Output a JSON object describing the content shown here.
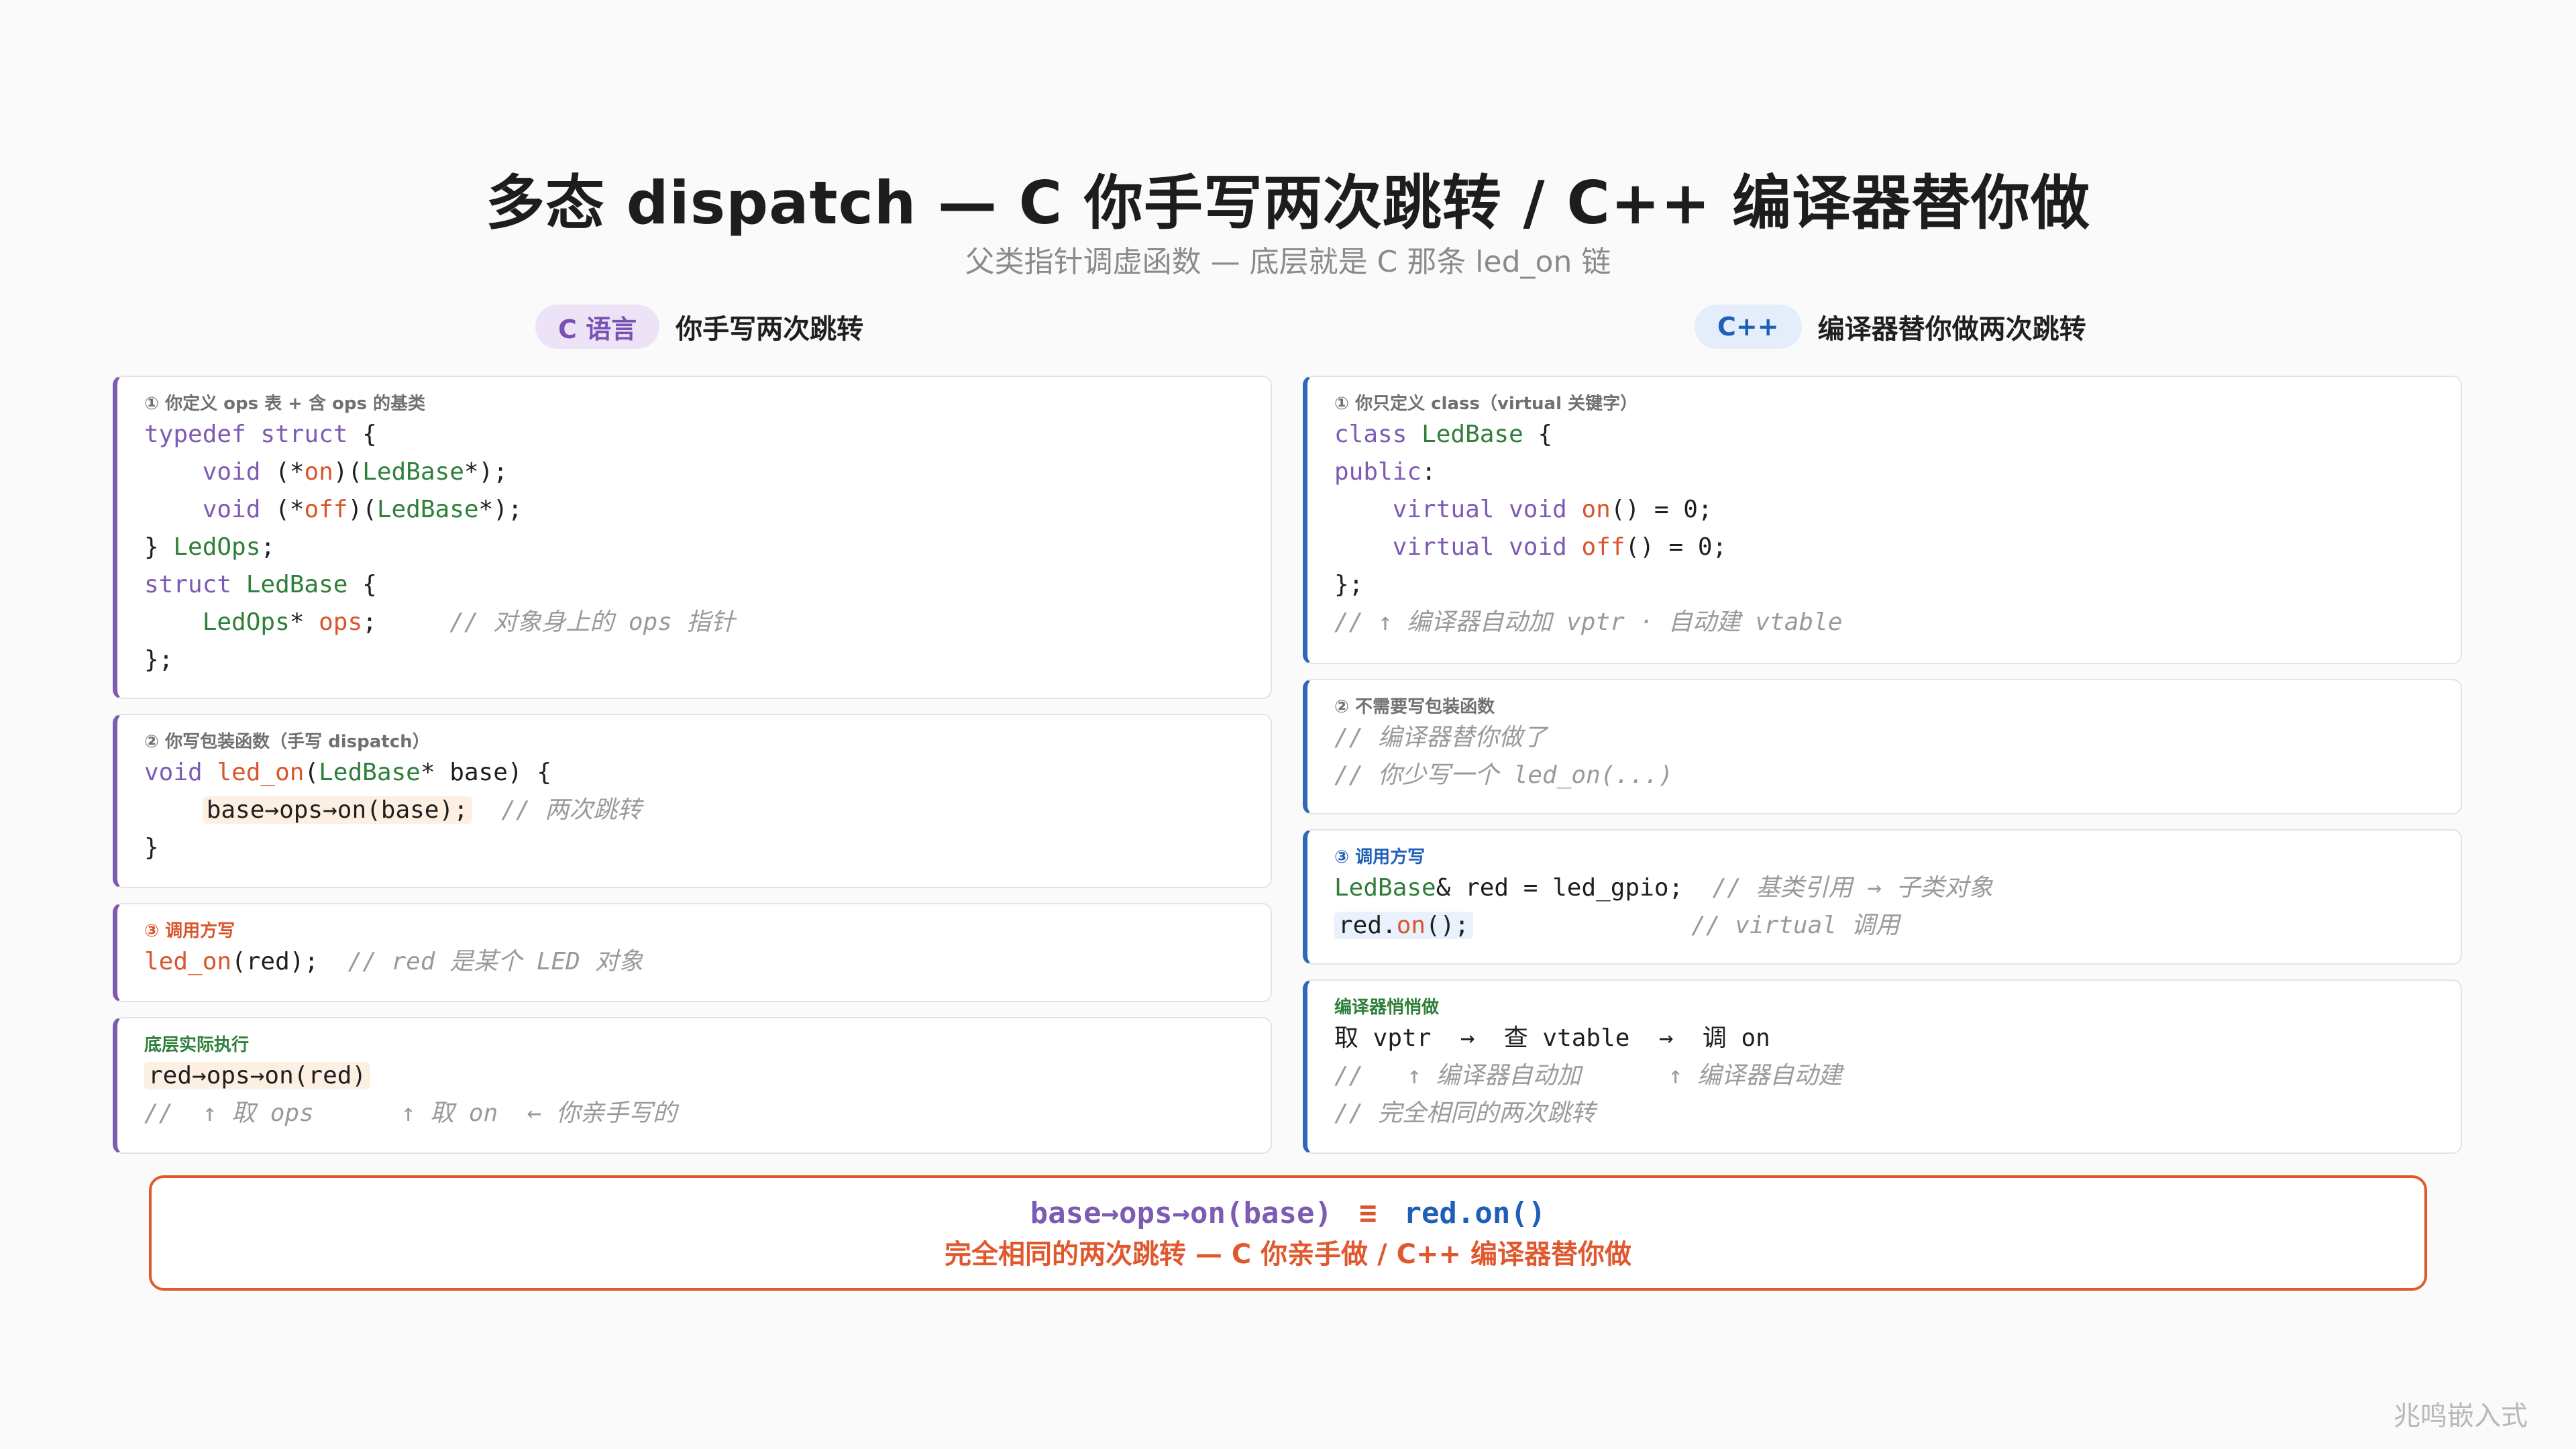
{
  "title": "多态 dispatch — C 你手写两次跳转 / C++ 编译器替你做",
  "subtitle": "父类指针调虚函数 — 底层就是 C 那条 led_on 链",
  "left_column": {
    "tag": "C 语言",
    "label": "你手写两次跳转",
    "card1_label": "① 你定义 ops 表 + 含 ops 的基类",
    "card2_label": "② 你写包装函数（手写 dispatch）",
    "card3_label": "③ 调用方写",
    "card4_label": "底层实际执行"
  },
  "right_column": {
    "tag": "C++",
    "label": "编译器替你做两次跳转",
    "card1_label": "① 你只定义 class（virtual 关键字）",
    "card2_label": "② 不需要写包装函数",
    "card3_label": "③ 调用方写",
    "card4_label": "编译器悄悄做"
  },
  "summary": {
    "c_expr": "base→ops→on(base)",
    "equals": "≡",
    "cpp_expr": "red.on()",
    "caption": "完全相同的两次跳转 — C 你亲手做 / C++ 编译器替你做"
  },
  "watermark": "兆鸣嵌入式"
}
